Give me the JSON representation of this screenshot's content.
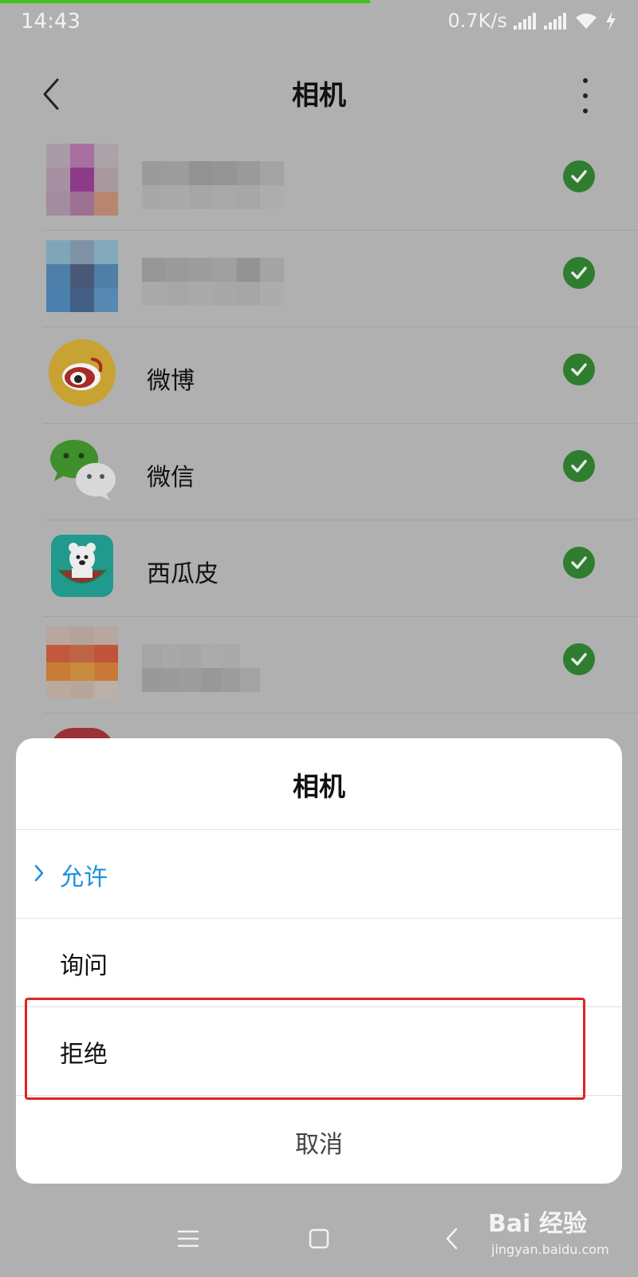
{
  "status_bar": {
    "time": "14:43",
    "speed": "0.7K/s",
    "progress_fraction": 0.58
  },
  "header": {
    "title": "相机",
    "back_icon": "chevron-left-icon",
    "more_icon": "more-vertical-icon"
  },
  "apps": [
    {
      "label": "",
      "blurred": true,
      "permission": "allowed"
    },
    {
      "label": "",
      "blurred": true,
      "permission": "allowed"
    },
    {
      "label": "微博",
      "blurred": false,
      "permission": "allowed"
    },
    {
      "label": "微信",
      "blurred": false,
      "permission": "allowed"
    },
    {
      "label": "西瓜皮",
      "blurred": false,
      "permission": "allowed"
    },
    {
      "label": "",
      "blurred": true,
      "permission": "allowed"
    }
  ],
  "dialog": {
    "title": "相机",
    "options": [
      {
        "label": "允许",
        "selected": true
      },
      {
        "label": "询问",
        "selected": false
      },
      {
        "label": "拒绝",
        "selected": false
      }
    ],
    "cancel_label": "取消",
    "highlighted_option": "拒绝"
  },
  "watermark": {
    "logo": "Bai 经验",
    "url": "jingyan.baidu.com"
  },
  "colors": {
    "accent": "#1d8fe0",
    "check_green": "#2f7d2f",
    "highlight_red": "#e02424",
    "overlay": "#b0b0b0"
  }
}
